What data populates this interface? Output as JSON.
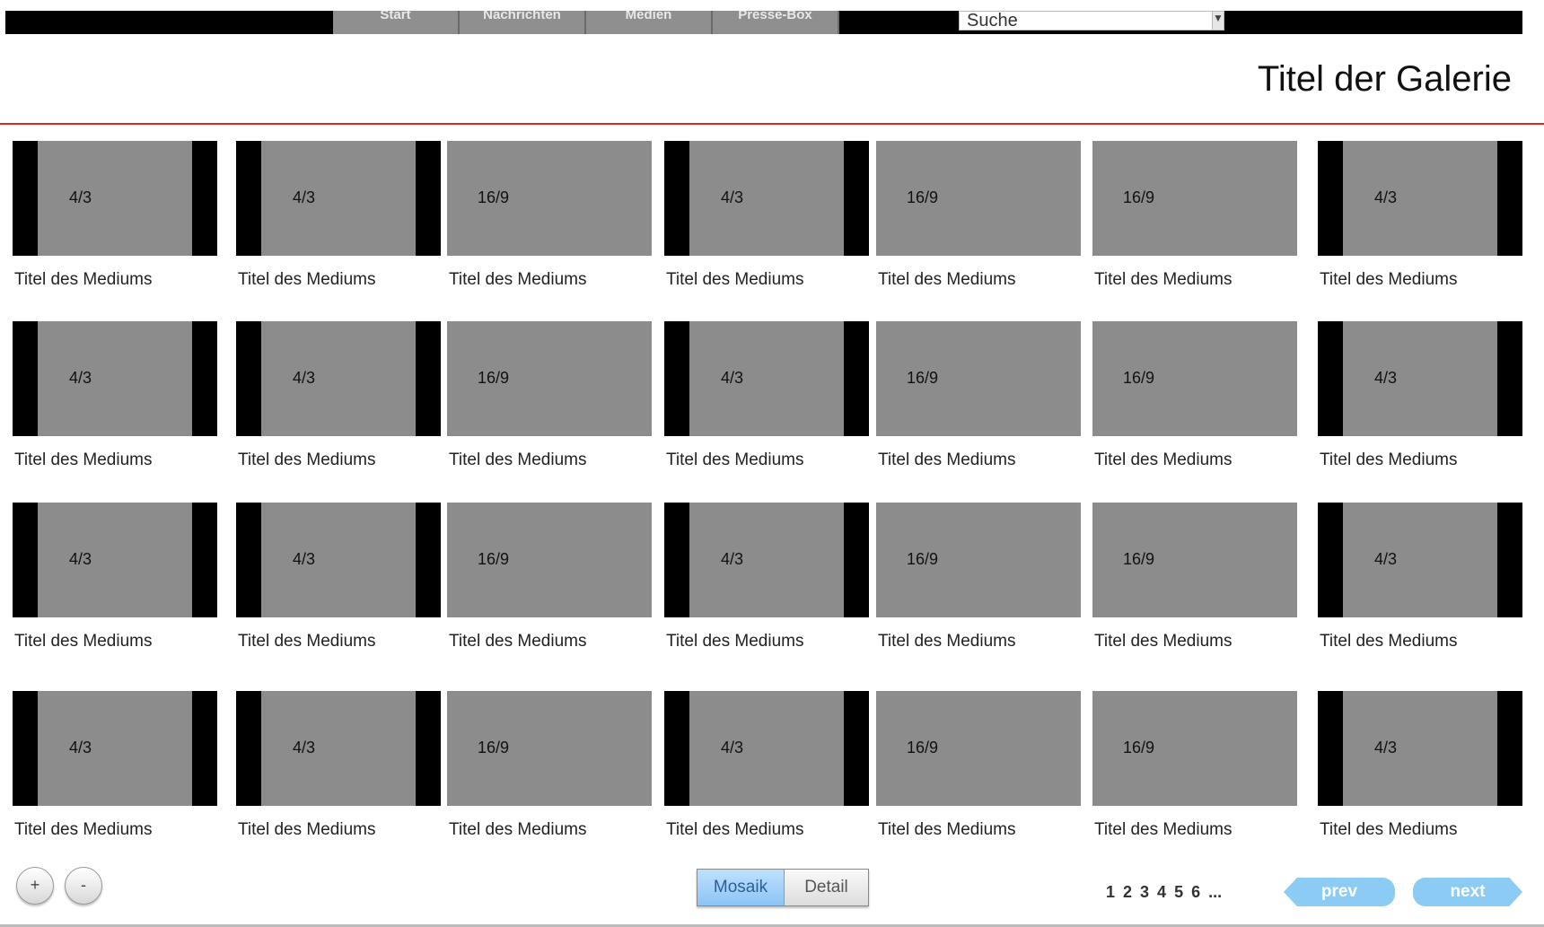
{
  "nav": {
    "items": [
      "Start",
      "Nachrichten",
      "Medien",
      "Presse-Box"
    ]
  },
  "search": {
    "value": "Suche",
    "dropdown_icon": "chevron-down-icon"
  },
  "gallery": {
    "title": "Titel der Galerie"
  },
  "tiles": {
    "rows": 4,
    "pattern": [
      "4/3",
      "4/3",
      "16/9",
      "4/3",
      "16/9",
      "16/9",
      "4/3"
    ],
    "caption": "Titel des Mediums"
  },
  "zoom": {
    "in": "+",
    "out": "-"
  },
  "view": {
    "mosaic": "Mosaik",
    "detail": "Detail",
    "active": "mosaic"
  },
  "pager": {
    "pages": [
      "1",
      "2",
      "3",
      "4",
      "5",
      "6",
      "..."
    ],
    "prev": "prev",
    "next": "next"
  },
  "colors": {
    "accent_rule": "#e0262b",
    "pager_button": "#8ccbf4",
    "active_toggle": "#8cc4f5"
  }
}
